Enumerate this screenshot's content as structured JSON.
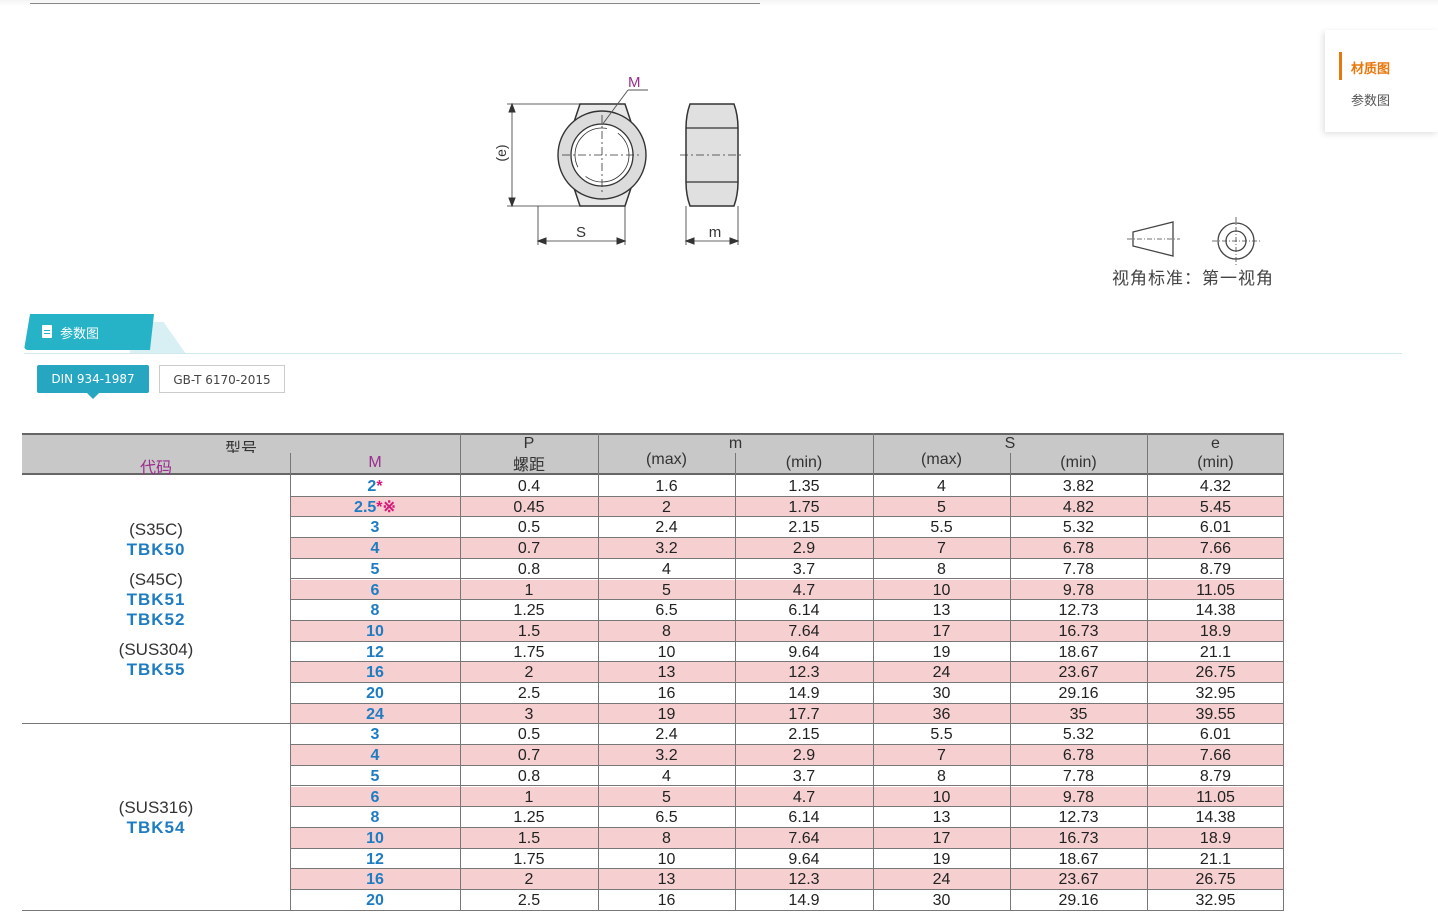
{
  "nav": {
    "active_label": "材质图",
    "second_label": "参数图"
  },
  "drawing": {
    "label_M": "M",
    "label_e": "(e)",
    "label_S": "S",
    "label_m": "m",
    "projection_label": "视角标准：第一视角"
  },
  "section": {
    "title": "参数图",
    "tabs": [
      "DIN 934-1987",
      "GB-T 6170-2015"
    ],
    "active_tab": 0
  },
  "table": {
    "header_row1": [
      "型号",
      "P",
      "m",
      "S",
      "e"
    ],
    "header_row2": [
      "代码",
      "M",
      "螺距",
      "(max)",
      "(min)",
      "(max)",
      "(min)",
      "(min)"
    ],
    "groups": [
      {
        "codes": [
          {
            "material": "(S35C)",
            "codes": [
              "TBK50"
            ]
          },
          {
            "material": "(S45C)",
            "codes": [
              "TBK51",
              "TBK52"
            ]
          },
          {
            "material": "(SUS304)",
            "codes": [
              "TBK55"
            ]
          }
        ],
        "rows": [
          {
            "M": "2",
            "mark": "*",
            "P": "0.4",
            "m_max": "1.6",
            "m_min": "1.35",
            "S_max": "4",
            "S_min": "3.82",
            "e_min": "4.32"
          },
          {
            "M": "2.5",
            "mark": "*※",
            "P": "0.45",
            "m_max": "2",
            "m_min": "1.75",
            "S_max": "5",
            "S_min": "4.82",
            "e_min": "5.45"
          },
          {
            "M": "3",
            "mark": "",
            "P": "0.5",
            "m_max": "2.4",
            "m_min": "2.15",
            "S_max": "5.5",
            "S_min": "5.32",
            "e_min": "6.01"
          },
          {
            "M": "4",
            "mark": "",
            "P": "0.7",
            "m_max": "3.2",
            "m_min": "2.9",
            "S_max": "7",
            "S_min": "6.78",
            "e_min": "7.66"
          },
          {
            "M": "5",
            "mark": "",
            "P": "0.8",
            "m_max": "4",
            "m_min": "3.7",
            "S_max": "8",
            "S_min": "7.78",
            "e_min": "8.79"
          },
          {
            "M": "6",
            "mark": "",
            "P": "1",
            "m_max": "5",
            "m_min": "4.7",
            "S_max": "10",
            "S_min": "9.78",
            "e_min": "11.05"
          },
          {
            "M": "8",
            "mark": "",
            "P": "1.25",
            "m_max": "6.5",
            "m_min": "6.14",
            "S_max": "13",
            "S_min": "12.73",
            "e_min": "14.38"
          },
          {
            "M": "10",
            "mark": "",
            "P": "1.5",
            "m_max": "8",
            "m_min": "7.64",
            "S_max": "17",
            "S_min": "16.73",
            "e_min": "18.9"
          },
          {
            "M": "12",
            "mark": "",
            "P": "1.75",
            "m_max": "10",
            "m_min": "9.64",
            "S_max": "19",
            "S_min": "18.67",
            "e_min": "21.1"
          },
          {
            "M": "16",
            "mark": "",
            "P": "2",
            "m_max": "13",
            "m_min": "12.3",
            "S_max": "24",
            "S_min": "23.67",
            "e_min": "26.75"
          },
          {
            "M": "20",
            "mark": "",
            "P": "2.5",
            "m_max": "16",
            "m_min": "14.9",
            "S_max": "30",
            "S_min": "29.16",
            "e_min": "32.95"
          },
          {
            "M": "24",
            "mark": "",
            "P": "3",
            "m_max": "19",
            "m_min": "17.7",
            "S_max": "36",
            "S_min": "35",
            "e_min": "39.55"
          }
        ]
      },
      {
        "codes": [
          {
            "material": "(SUS316)",
            "codes": [
              "TBK54"
            ]
          }
        ],
        "rows": [
          {
            "M": "3",
            "mark": "",
            "P": "0.5",
            "m_max": "2.4",
            "m_min": "2.15",
            "S_max": "5.5",
            "S_min": "5.32",
            "e_min": "6.01"
          },
          {
            "M": "4",
            "mark": "",
            "P": "0.7",
            "m_max": "3.2",
            "m_min": "2.9",
            "S_max": "7",
            "S_min": "6.78",
            "e_min": "7.66"
          },
          {
            "M": "5",
            "mark": "",
            "P": "0.8",
            "m_max": "4",
            "m_min": "3.7",
            "S_max": "8",
            "S_min": "7.78",
            "e_min": "8.79"
          },
          {
            "M": "6",
            "mark": "",
            "P": "1",
            "m_max": "5",
            "m_min": "4.7",
            "S_max": "10",
            "S_min": "9.78",
            "e_min": "11.05"
          },
          {
            "M": "8",
            "mark": "",
            "P": "1.25",
            "m_max": "6.5",
            "m_min": "6.14",
            "S_max": "13",
            "S_min": "12.73",
            "e_min": "14.38"
          },
          {
            "M": "10",
            "mark": "",
            "P": "1.5",
            "m_max": "8",
            "m_min": "7.64",
            "S_max": "17",
            "S_min": "16.73",
            "e_min": "18.9"
          },
          {
            "M": "12",
            "mark": "",
            "P": "1.75",
            "m_max": "10",
            "m_min": "9.64",
            "S_max": "19",
            "S_min": "18.67",
            "e_min": "21.1"
          },
          {
            "M": "16",
            "mark": "",
            "P": "2",
            "m_max": "13",
            "m_min": "12.3",
            "S_max": "24",
            "S_min": "23.67",
            "e_min": "26.75"
          },
          {
            "M": "20",
            "mark": "",
            "P": "2.5",
            "m_max": "16",
            "m_min": "14.9",
            "S_max": "30",
            "S_min": "29.16",
            "e_min": "32.95"
          }
        ]
      }
    ],
    "colors": {
      "code_blue": "#1e7cc2",
      "mark_magenta": "#d6187a",
      "row_pink": "#f6d0d0",
      "header_gray": "#c8c8c8",
      "accent_teal": "#26b3c8",
      "nav_orange": "#e8770d"
    }
  }
}
